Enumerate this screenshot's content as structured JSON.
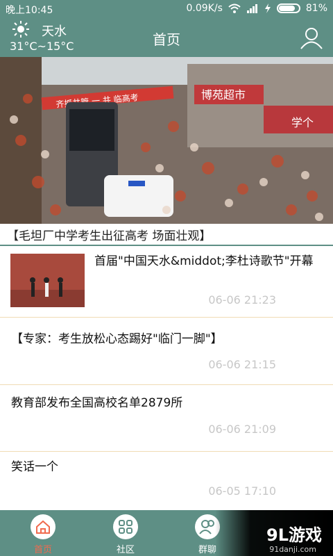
{
  "status_bar": {
    "time": "晚上10:45",
    "speed": "0.09K/s",
    "battery_percent": "81%",
    "battery_level": 0.81
  },
  "header": {
    "city": "天水",
    "temperature": "31°C~15°C",
    "title": "首页"
  },
  "banner": {
    "caption": "【毛坦厂中学考生出征高考 场面壮观】",
    "banner_text": "齐抓共管 一 共 临高考",
    "shop_sign": "博苑超市",
    "shop_sign2": "学个"
  },
  "news": [
    {
      "headline": "首届\"中国天水&middot;李杜诗歌节\"开幕",
      "time": "06-06 21:23"
    },
    {
      "headline": "【专家：考生放松心态踢好\"临门一脚\"】",
      "time": "06-06 21:15"
    },
    {
      "headline": "教育部发布全国高校名单2879所",
      "time": "06-06 21:09"
    },
    {
      "headline": "笑话一个",
      "time": "06-05 17:10"
    }
  ],
  "tabs": [
    {
      "label": "首页",
      "icon": "home-icon",
      "active": true
    },
    {
      "label": "社区",
      "icon": "grid-icon",
      "active": false
    },
    {
      "label": "群聊",
      "icon": "group-icon",
      "active": false
    }
  ],
  "watermark": {
    "main": "9L游戏",
    "sub": "91danji.com"
  },
  "colors": {
    "theme": "#5e8f85",
    "accent": "#f06b4f",
    "divider": "#f0dcb4",
    "time": "#c7c7c7"
  }
}
